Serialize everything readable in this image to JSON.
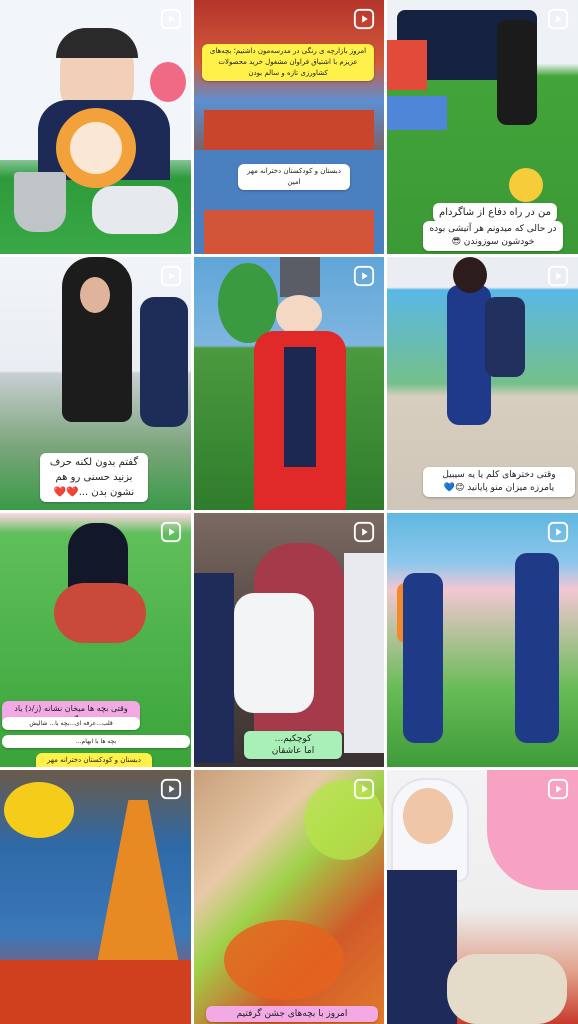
{
  "feed": {
    "tiles": [
      {
        "captions": []
      },
      {
        "captions": [
          "امروز بازارچه ی رنگی در مدرسه‌مون داشتیم؛ بچه‌های عزیزم با اشتیاق فراوان مشغول خرید محصولات کشاورزی تازه و سالم بودن",
          "دبستان و کودکستان دخترانه مهر امین"
        ]
      },
      {
        "captions": [
          "من در راه دفاع از شاگردام",
          "در حالی که میدونم هر آتیشی بوده خودشون سوزوندن 😎"
        ]
      },
      {
        "captions": [
          "گفتم بدون لکنه حرف بزنید حسنی رو هم نشون بدن ...❤️❤️"
        ]
      },
      {
        "captions": []
      },
      {
        "captions": [
          "وقتی دخترهای کلم یا یه سیبیل یامرزه میزان منو پایانید 😊💙"
        ]
      },
      {
        "captions": [
          "وقتی بچه ها میخان نشانه (ز/ذ) یاد بگیرند",
          "قلب...عرفه ای...بچه با... شالیش",
          "بچه ها با ابهام...",
          "دبستان و کودکستان دخترانه مهر امین"
        ]
      },
      {
        "captions": [
          "کوچکیم...",
          "اما عاشقان"
        ]
      },
      {
        "captions": []
      },
      {
        "captions": []
      },
      {
        "captions": [
          "امروز با بچه‌های جشن گرفتیم"
        ]
      },
      {
        "captions": []
      }
    ]
  },
  "icons": {
    "reel": "reel-icon"
  },
  "colors": {
    "reel_icon": "#ffffff",
    "caption_bg": "#ffffff",
    "caption_yellow": "#fff04a",
    "caption_pink": "#f3a9e3"
  }
}
